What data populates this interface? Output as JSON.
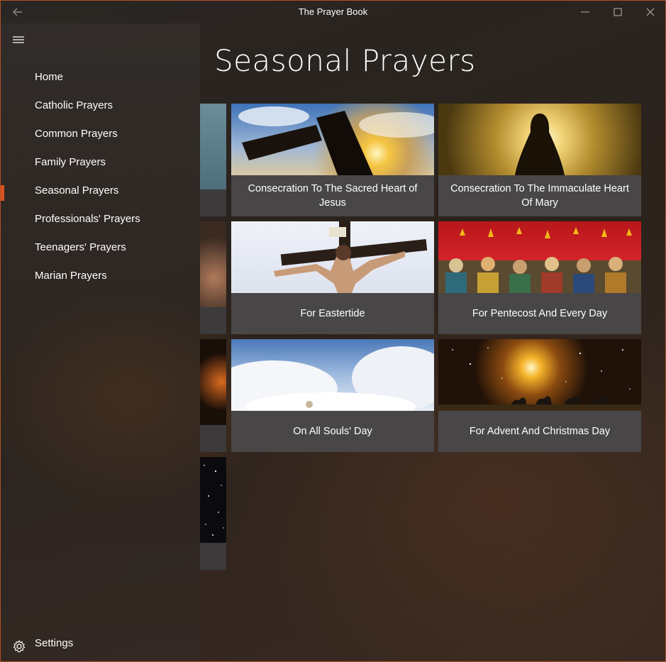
{
  "window": {
    "title": "The Prayer Book"
  },
  "sidebar": {
    "items": [
      {
        "label": "Home"
      },
      {
        "label": "Catholic Prayers"
      },
      {
        "label": "Common Prayers"
      },
      {
        "label": "Family Prayers"
      },
      {
        "label": "Seasonal Prayers",
        "selected": true
      },
      {
        "label": "Professionals' Prayers"
      },
      {
        "label": "Teenagers' Prayers"
      },
      {
        "label": "Marian Prayers"
      }
    ],
    "settings_label": "Settings"
  },
  "main": {
    "title": "Seasonal Prayers",
    "tiles": [
      {
        "caption": "Consecration To The Sacred Heart of Jesus"
      },
      {
        "caption": "Consecration To The Immaculate Heart Of Mary"
      },
      {
        "caption": "For Eastertide"
      },
      {
        "caption": "For Pentecost And Every Day"
      },
      {
        "caption": "On All Souls' Day"
      },
      {
        "caption": "For Advent And Christmas Day"
      }
    ]
  },
  "colors": {
    "accent": "#d9531e",
    "tile_caption_bg": "#4a4648"
  }
}
